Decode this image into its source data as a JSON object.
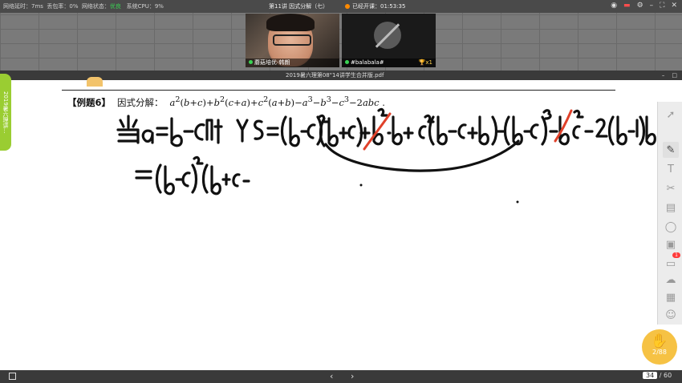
{
  "topbar": {
    "latency": "网络延时：7ms",
    "packet_loss": "丢包率：0%",
    "net_status_label": "网络状态：",
    "net_status_value": "优良",
    "cpu": "系统CPU：9%",
    "lesson_title": "第11讲 因式分解（七）",
    "live_text": "已经开课：01:53:35"
  },
  "videos": {
    "teacher_name": "蘑菇培优-韩朗",
    "student_name": "#balabala#",
    "student_trophy": "x1"
  },
  "document": {
    "file_name": "2019暑六理第08\"14讲学生合并版.pdf",
    "side_tab": "2019暑六理讲...",
    "problem_tag": "【例题6】",
    "problem_label": "因式分解："
  },
  "handwriting": {
    "line1": "当a=b-c时 YS=(b-c)²(b+c)+b²·b+c²(b-c+b)-(b-c)³-b²c-2(b-c)bc",
    "line2": "=(b-c)²(b+c"
  },
  "toolbar": {
    "tools": [
      "pointer-icon",
      "pen-icon",
      "text-icon",
      "scissors-icon",
      "delete-icon",
      "shape-icon",
      "image-icon",
      "chat-icon",
      "cloud-icon",
      "toolbox-icon",
      "users-icon"
    ],
    "chat_badge": "1",
    "hand_label": "2/88"
  },
  "bottombar": {
    "current_page": "34",
    "total_pages": "/ 60"
  },
  "colors": {
    "accent_green": "#39d353",
    "hand_orange": "#f6c244",
    "side_tab_green": "#9acd32"
  }
}
